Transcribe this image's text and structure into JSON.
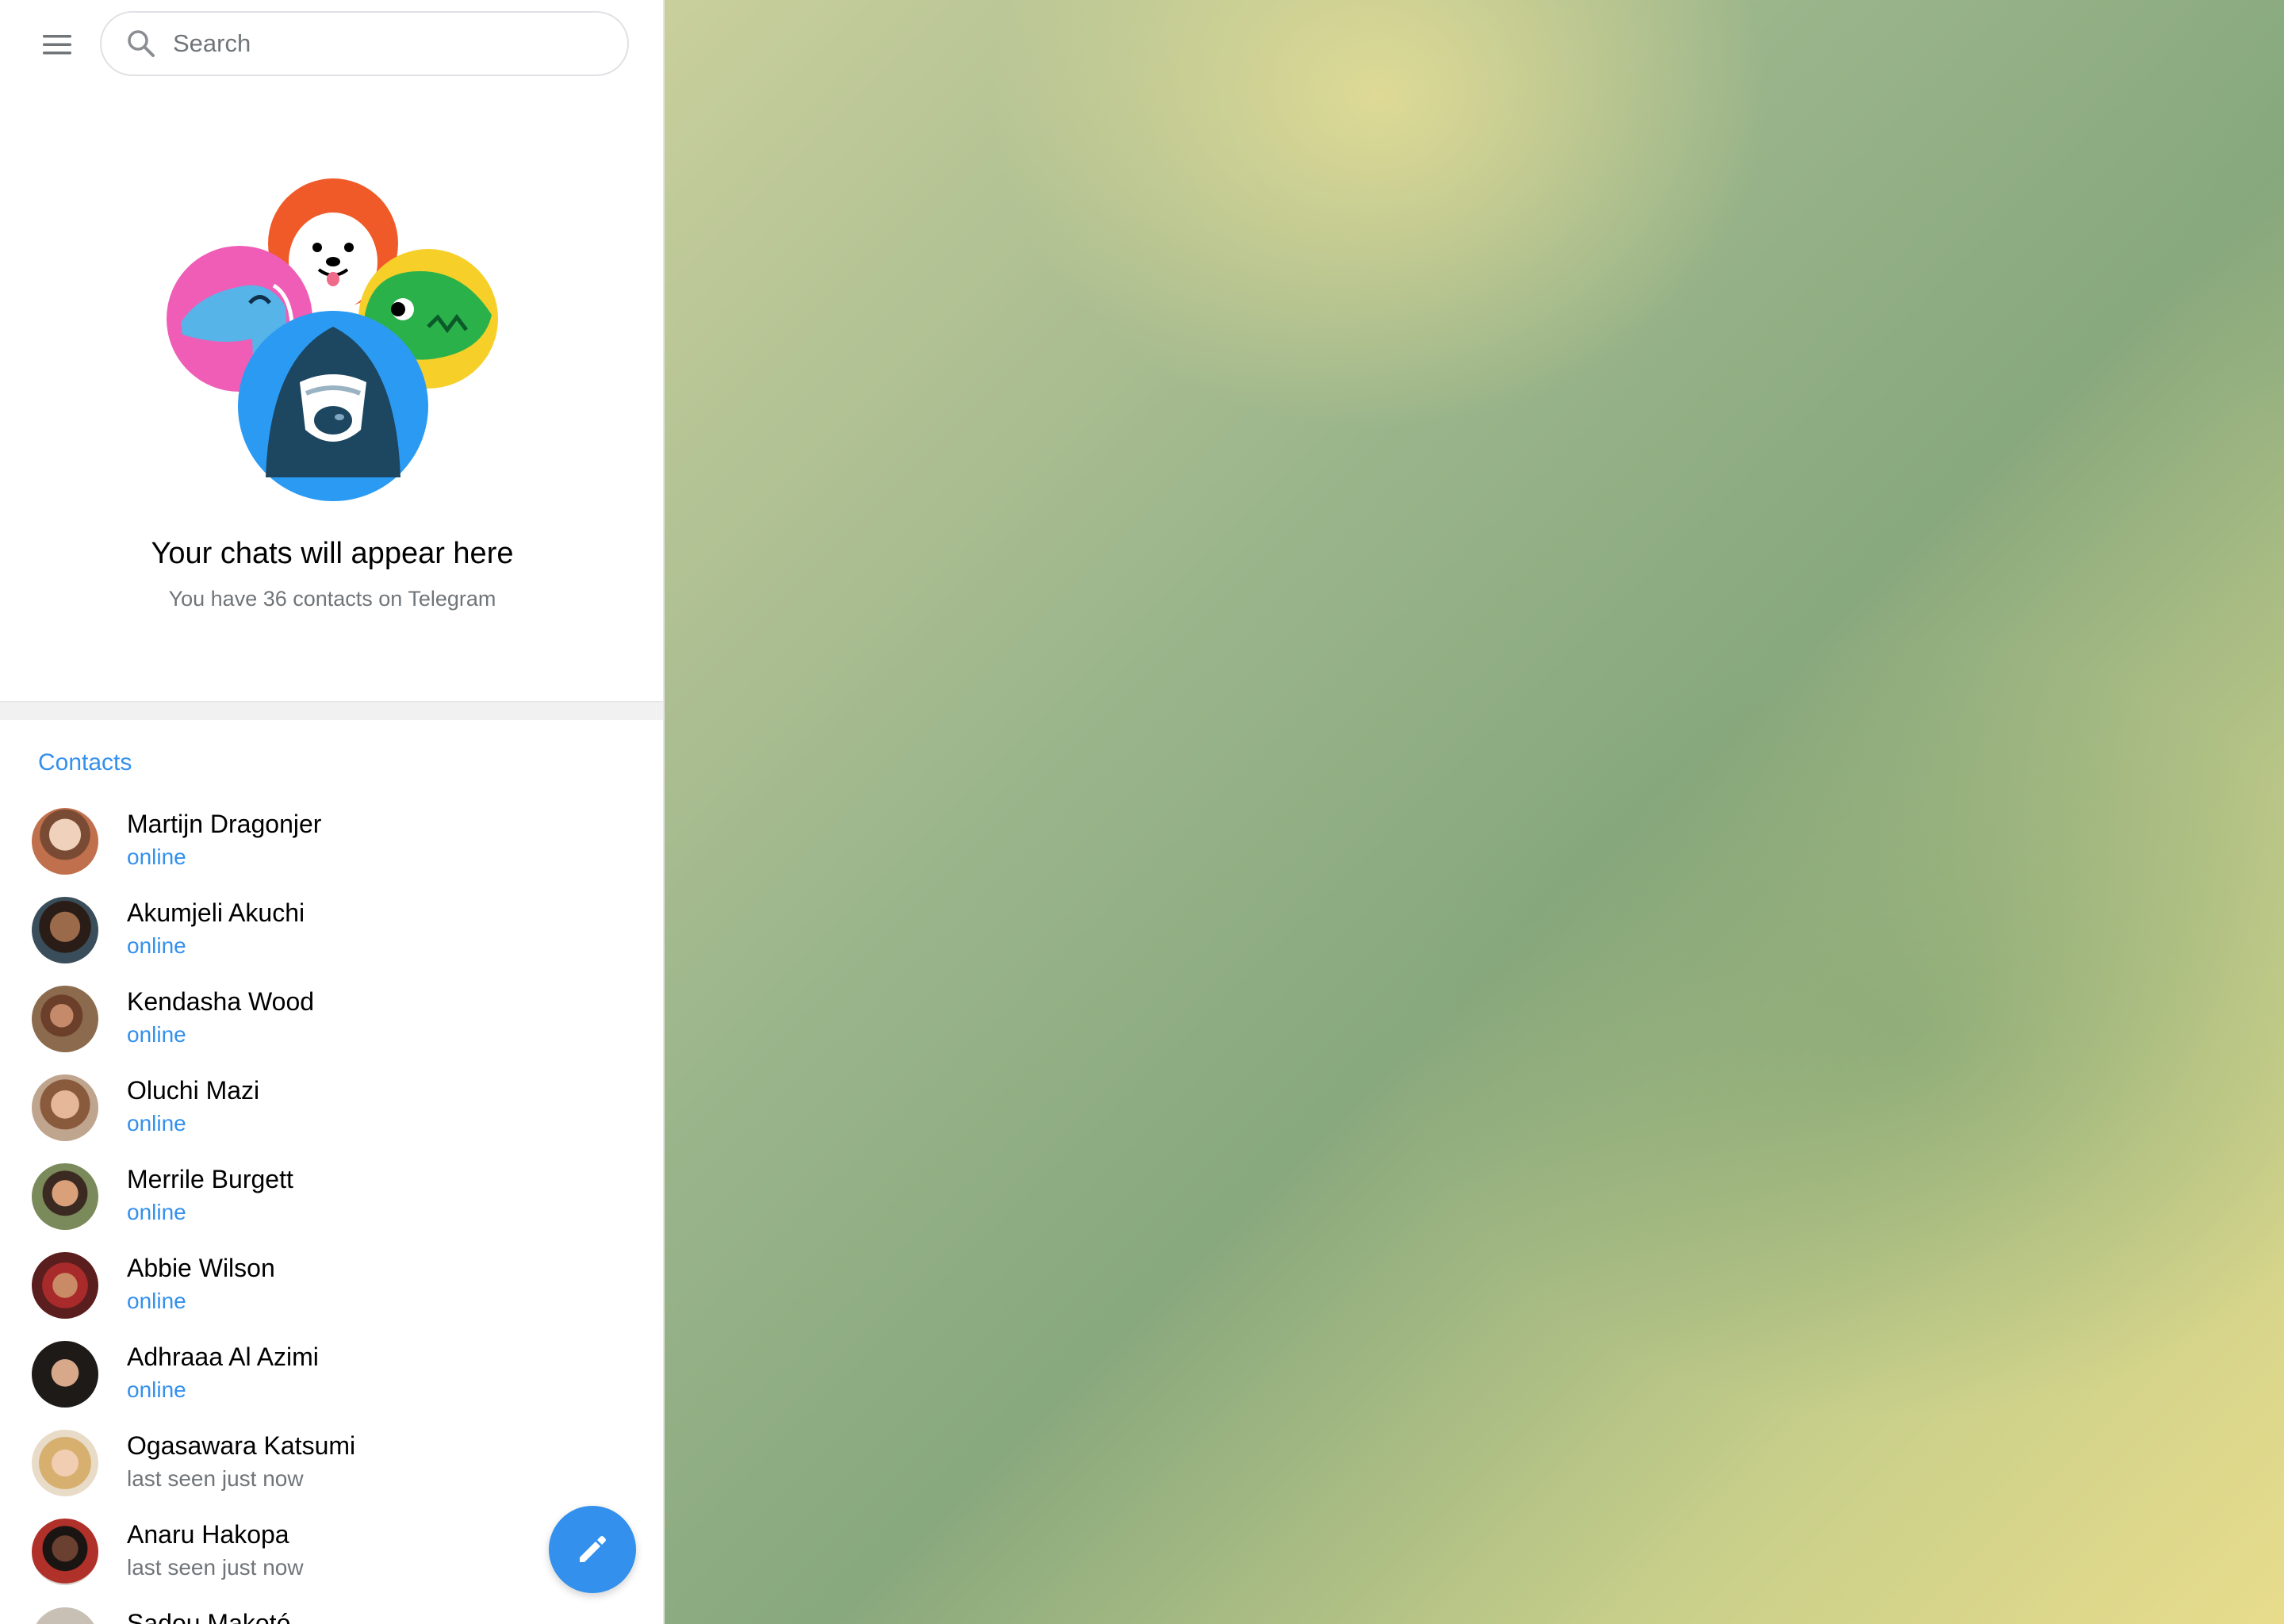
{
  "search": {
    "placeholder": "Search"
  },
  "empty_state": {
    "title": "Your chats will appear here",
    "subtitle": "You have 36 contacts on Telegram"
  },
  "contacts": {
    "header": "Contacts",
    "items": [
      {
        "name": "Martijn Dragonjer",
        "status": "online"
      },
      {
        "name": "Akumjeli Akuchi",
        "status": "online"
      },
      {
        "name": "Kendasha Wood",
        "status": "online"
      },
      {
        "name": "Oluchi Mazi",
        "status": "online"
      },
      {
        "name": "Merrile Burgett",
        "status": "online"
      },
      {
        "name": "Abbie Wilson",
        "status": "online"
      },
      {
        "name": "Adhraaa Al Azimi",
        "status": "online"
      },
      {
        "name": "Ogasawara Katsumi",
        "status": "last seen just now"
      },
      {
        "name": "Anaru Hakopa",
        "status": "last seen just now"
      },
      {
        "name": "Sadou Makotó",
        "status": ""
      }
    ]
  },
  "icons": {
    "menu": "hamburger-menu-icon",
    "search": "search-icon",
    "compose": "pencil-icon"
  },
  "colors": {
    "accent": "#3390ec",
    "secondary_text": "#707579"
  }
}
